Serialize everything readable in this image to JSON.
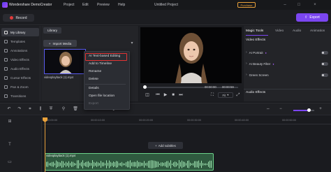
{
  "app": {
    "name": "Wondershare DemoCreator",
    "menus": [
      "Project",
      "Edit",
      "Preview",
      "Help"
    ],
    "project_title": "Untitled Project",
    "purchase_label": "Purchase"
  },
  "toolbar": {
    "record_label": "Record",
    "export_label": "Export"
  },
  "sidebar": {
    "items": [
      {
        "label": "My Library"
      },
      {
        "label": "Templates"
      },
      {
        "label": "Annotations"
      },
      {
        "label": "Video Effects"
      },
      {
        "label": "Audio Effects"
      },
      {
        "label": "Cursor Effects"
      },
      {
        "label": "Pan & Zoom"
      },
      {
        "label": "Transitions"
      }
    ]
  },
  "library": {
    "tab_label": "Library",
    "import_label": "Import Media",
    "clip_name": "videoplayback (1).mp4"
  },
  "context_menu": {
    "items": [
      "AI Text-based Editing",
      "Add to Timeline",
      "Rename",
      "Delete",
      "Details",
      "Open file location",
      "Export"
    ]
  },
  "preview": {
    "current_time": "00:00:00",
    "total_time": "00:00:59",
    "fit_label": "Fit",
    "progress": 0.0
  },
  "right_panel": {
    "tabs": [
      "Magic Tools",
      "Video",
      "Audio",
      "Animation"
    ],
    "video_effects_title": "Video Effects",
    "effects": [
      {
        "label": "AI Portrait"
      },
      {
        "label": "AI Beauty Filter"
      },
      {
        "label": "Green Screen"
      }
    ],
    "audio_effects_title": "Audio Effects"
  },
  "timeline": {
    "ruler_labels": [
      "00:00:00:00",
      "00:00:10:00",
      "00:00:20:00",
      "00:00:30:00",
      "00:00:40:00",
      "00:00:50:00"
    ],
    "add_subtitles_label": "Add subtitles",
    "clip_name": "videoplayback (1).mp4"
  },
  "colors": {
    "accent": "#7b46f1",
    "record": "#e23b3b",
    "purchase": "#e9a13b",
    "highlight_box": "#e33333",
    "clip": "#2f5a3f"
  }
}
